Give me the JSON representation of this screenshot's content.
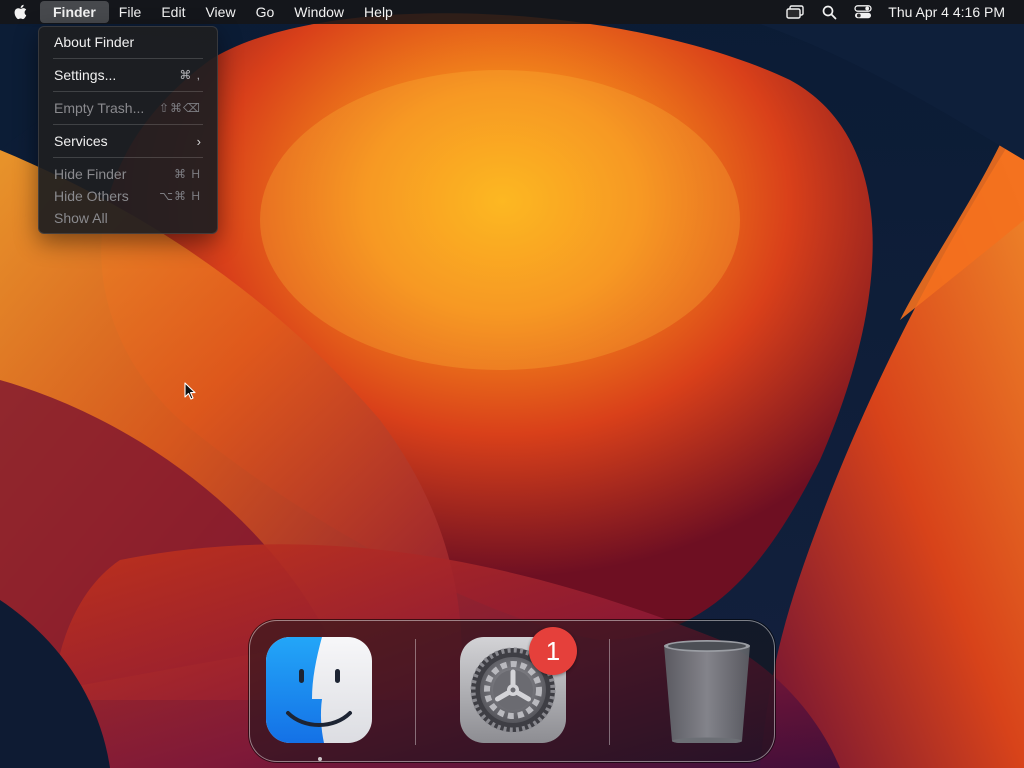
{
  "menubar": {
    "apple_icon": "apple-logo-icon",
    "app_name": "Finder",
    "menus": [
      "File",
      "Edit",
      "View",
      "Go",
      "Window",
      "Help"
    ],
    "status_icons": [
      "screen-mirroring-icon",
      "spotlight-search-icon",
      "control-center-icon"
    ],
    "clock": "Thu Apr 4  4:16 PM"
  },
  "finder_menu": {
    "about": "About Finder",
    "settings": "Settings...",
    "settings_shortcut": "⌘ ,",
    "empty_trash": "Empty Trash...",
    "empty_trash_shortcut": "⇧⌘⌫",
    "services": "Services",
    "services_chevron": "›",
    "hide_finder": "Hide Finder",
    "hide_finder_shortcut": "⌘ H",
    "hide_others": "Hide Others",
    "hide_others_shortcut": "⌥⌘ H",
    "show_all": "Show All"
  },
  "dock": {
    "apps": [
      {
        "icon": "finder-icon",
        "running": true
      },
      {
        "icon": "system-settings-icon",
        "badge": "1"
      },
      {
        "icon": "trash-icon"
      }
    ]
  },
  "colors": {
    "menubar_bg": "#161618",
    "menu_bg": "#1e1e20",
    "badge_red": "#e5403b",
    "finder_blue": "#1f8ef1",
    "wallpaper_orange": "#f07a1a"
  }
}
